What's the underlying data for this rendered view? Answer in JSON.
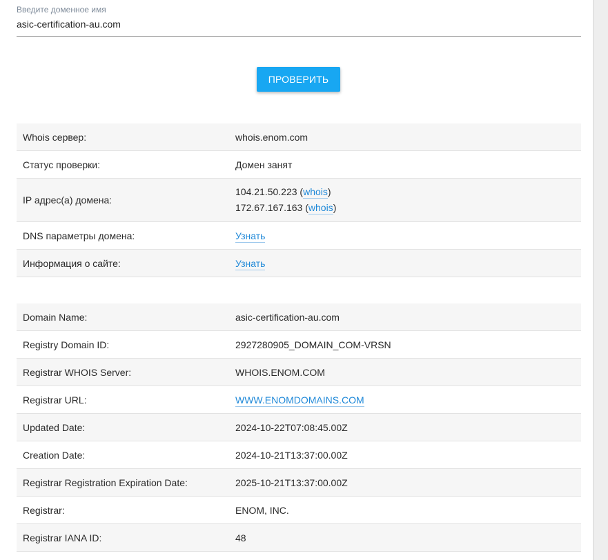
{
  "domain_field": {
    "label": "Введите доменное имя",
    "value": "asic-certification-au.com"
  },
  "check_button": {
    "label": "ПРОВЕРИТЬ"
  },
  "summary": {
    "whois_server": {
      "key": "Whois сервер:",
      "value": "whois.enom.com"
    },
    "status": {
      "key": "Статус проверки:",
      "value": "Домен занят"
    },
    "ip": {
      "key": "IP адрес(а) домена:",
      "addresses": [
        {
          "ip": "104.21.50.223",
          "link": "whois"
        },
        {
          "ip": "172.67.167.163",
          "link": "whois"
        }
      ]
    },
    "dns": {
      "key": "DNS параметры домена:",
      "link": "Узнать"
    },
    "site_info": {
      "key": "Информация о сайте:",
      "link": "Узнать"
    }
  },
  "whois_records": [
    {
      "key": "Domain Name:",
      "value": "asic-certification-au.com"
    },
    {
      "key": "Registry Domain ID:",
      "value": "2927280905_DOMAIN_COM-VRSN"
    },
    {
      "key": "Registrar WHOIS Server:",
      "value": "WHOIS.ENOM.COM"
    },
    {
      "key": "Registrar URL:",
      "value": "WWW.ENOMDOMAINS.COM"
    },
    {
      "key": "Updated Date:",
      "value": "2024-10-22T07:08:45.00Z"
    },
    {
      "key": "Creation Date:",
      "value": "2024-10-21T13:37:00.00Z"
    },
    {
      "key": "Registrar Registration Expiration Date:",
      "value": "2025-10-21T13:37:00.00Z"
    },
    {
      "key": "Registrar:",
      "value": "ENOM, INC."
    },
    {
      "key": "Registrar IANA ID:",
      "value": "48"
    }
  ],
  "colors": {
    "button": "#18a7f2",
    "link": "#1e88d8",
    "row_alt": "#f6f6f6"
  }
}
